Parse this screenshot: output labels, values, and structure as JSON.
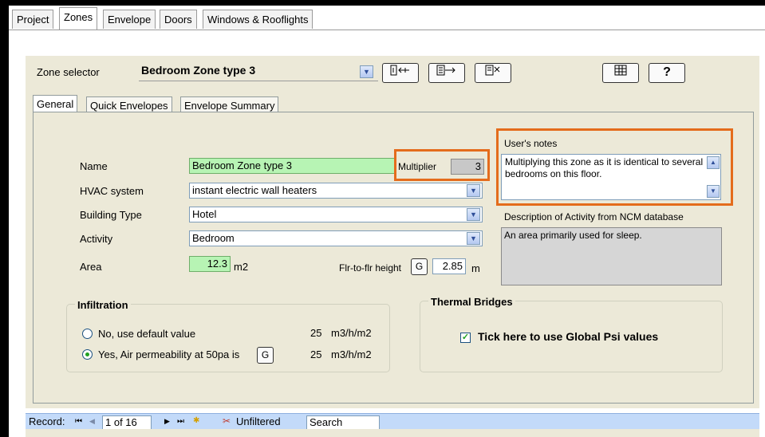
{
  "top_tabs": [
    "Project",
    "Zones",
    "Envelope",
    "Doors",
    "Windows & Rooflights"
  ],
  "zone_selector": {
    "label": "Zone selector",
    "value": "Bedroom Zone type 3"
  },
  "toolbar": {
    "icons": [
      "insert-zone-icon",
      "next-zone-icon",
      "delete-zone-icon",
      "table-icon",
      "help-icon"
    ]
  },
  "inner_tabs": [
    "General",
    "Quick Envelopes",
    "Envelope Summary"
  ],
  "general": {
    "name_label": "Name",
    "name_value": "Bedroom Zone type 3",
    "multiplier_label": "Multiplier",
    "multiplier_value": "3",
    "hvac_label": "HVAC system",
    "hvac_value": "instant electric wall heaters",
    "building_type_label": "Building Type",
    "building_type_value": "Hotel",
    "activity_label": "Activity",
    "activity_value": "Bedroom",
    "area_label": "Area",
    "area_value": "12.3",
    "area_unit": "m2",
    "flr_label": "Flr-to-flr height",
    "flr_g": "G",
    "flr_value": "2.85",
    "flr_unit": "m"
  },
  "notes": {
    "label": "User's notes",
    "text": "Multiplying this zone as it is identical to several bedrooms on this floor.",
    "ncm_label": "Description of Activity from NCM database",
    "ncm_text": "An area primarily used for sleep."
  },
  "infiltration": {
    "title": "Infiltration",
    "option1_label": "No, use default value",
    "option1_value": "25",
    "option1_unit": "m3/h/m2",
    "option2_label": "Yes, Air permeability at 50pa is",
    "option2_g": "G",
    "option2_value": "25",
    "option2_unit": "m3/h/m2",
    "selected": 2
  },
  "thermal_bridges": {
    "title": "Thermal Bridges",
    "checkbox_label": "Tick here to use Global Psi values",
    "checked": true
  },
  "record_bar": {
    "record_label": "Record:",
    "position": "1 of 16",
    "filter_label": "Unfiltered",
    "search_label": "Search"
  },
  "colors": {
    "highlight": "#e46c1c",
    "green_field": "#b7f4b4",
    "record_bar": "#c3daf9"
  }
}
